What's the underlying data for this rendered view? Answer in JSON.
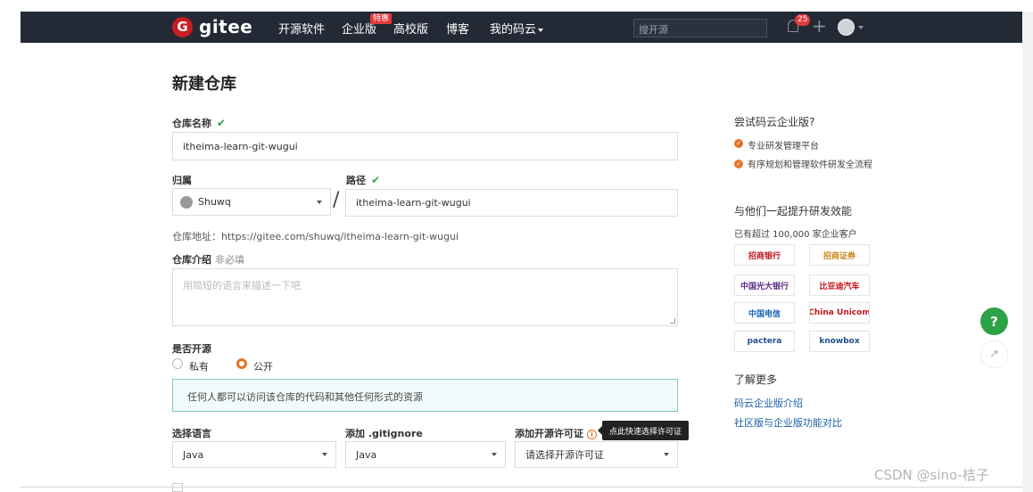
{
  "navbar": {
    "logo_text": "gitee",
    "links": [
      "开源软件",
      "企业版",
      "高校版",
      "博客",
      "我的码云"
    ],
    "special_badge": "特惠",
    "search_placeholder": "搜开源",
    "notification_count": "25"
  },
  "form": {
    "title": "新建仓库",
    "repo_name_label": "仓库名称",
    "repo_name_value": "itheima-learn-git-wugui",
    "owner_label": "归属",
    "owner_value": "Shuwq",
    "path_label": "路径",
    "path_value": "itheima-learn-git-wugui",
    "address_text": "仓库地址：https://gitee.com/shuwq/itheima-learn-git-wugui",
    "desc_label": "仓库介绍",
    "desc_optional": "非必填",
    "desc_placeholder": "用简短的语言来描述一下吧",
    "open_source_label": "是否开源",
    "private_label": "私有",
    "public_label": "公开",
    "info_text": "任何人都可以访问该仓库的代码和其他任何形式的资源",
    "language_label": "选择语言",
    "language_value": "Java",
    "gitignore_label": "添加 .gitignore",
    "gitignore_value": "Java",
    "license_label": "添加开源许可证",
    "license_placeholder": "请选择开源许可证",
    "license_tooltip": "点此快速选择许可证"
  },
  "sidebar": {
    "try_title": "尝试码云企业版?",
    "bullets": [
      "专业研发管理平台",
      "有序规划和管理软件研发全流程"
    ],
    "peers_title": "与他们一起提升研发效能",
    "customers_text": "已有超过 100,000 家企业客户",
    "customer_logos": [
      "招商银行",
      "招商证券",
      "中国光大银行",
      "比亚迪汽车",
      "中国电信",
      "China Unicom",
      "pactera",
      "knowbox"
    ],
    "more_title": "了解更多",
    "links": [
      "码云企业版介绍",
      "社区版与企业版功能对比"
    ]
  },
  "floating": {
    "help_label": "?"
  },
  "watermark": "CSDN @sino-桔子"
}
